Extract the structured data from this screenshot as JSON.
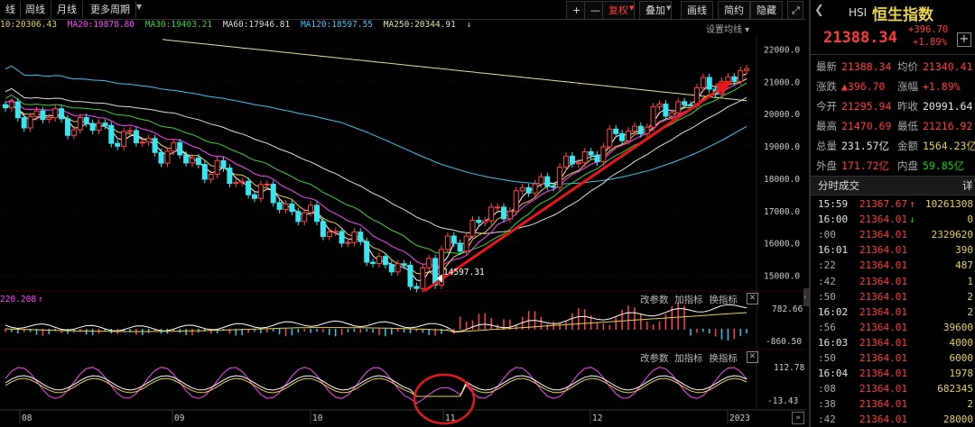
{
  "toolbar": {
    "tabs": [
      "线",
      "周线",
      "月线",
      "更多周期"
    ],
    "buttons": [
      "+",
      "—",
      "复权",
      "叠加",
      "画线",
      "简约",
      "隐藏"
    ]
  },
  "ma_legend": [
    {
      "label": "10:20306.43",
      "color": "#e8d24a"
    },
    {
      "label": "MA20:19878.80",
      "color": "#ff44ff"
    },
    {
      "label": "MA30:19403.21",
      "color": "#39d239"
    },
    {
      "label": "MA60:17946.81",
      "color": "#dddddd"
    },
    {
      "label": "MA120:18597.55",
      "color": "#39c6f0"
    },
    {
      "label": "MA250:20344.91",
      "color": "#e8e0a0"
    }
  ],
  "ma_settings_label": "设置均线",
  "macd_header": "220.208",
  "sub_actions": [
    "改参数",
    "加指标",
    "换指标"
  ],
  "chart_data": [
    {
      "type": "candlestick",
      "y_ticks": [
        "22000.0",
        "21000.0",
        "20000.0",
        "19000.0",
        "18000.0",
        "17000.0",
        "16000.0",
        "15000.0"
      ],
      "ylim": [
        14600,
        22400
      ],
      "x_ticks": [
        "08",
        "09",
        "10",
        "11",
        "12",
        "2023"
      ],
      "annotations": [
        "14597.31"
      ],
      "low_marker": 14597.31
    },
    {
      "type": "line",
      "name": "MACD",
      "y_ticks": [
        "782.66",
        "-860.50"
      ]
    },
    {
      "type": "line",
      "name": "KDJ",
      "y_ticks": [
        "112.78",
        "-13.43"
      ]
    }
  ],
  "quote": {
    "code": "HSI",
    "name": "恒生指数",
    "price": "21388.34",
    "change": "+396.70",
    "change_pct": "+1.89%",
    "fields": [
      {
        "l1": "最新",
        "v1": "21388.34",
        "c1": "red",
        "l2": "均价",
        "v2": "21340.41",
        "c2": "red"
      },
      {
        "l1": "涨跌",
        "v1": "▲396.70",
        "c1": "red",
        "l2": "涨幅",
        "v2": "+1.89%",
        "c2": "red"
      },
      {
        "l1": "今开",
        "v1": "21295.94",
        "c1": "red",
        "l2": "昨收",
        "v2": "20991.64",
        "c2": "white"
      },
      {
        "l1": "最高",
        "v1": "21470.69",
        "c1": "red",
        "l2": "最低",
        "v2": "21216.92",
        "c2": "red"
      },
      {
        "l1": "总量",
        "v1": "231.57亿",
        "c1": "white",
        "l2": "金额",
        "v2": "1564.23亿",
        "c2": "yellow"
      },
      {
        "l1": "外盘",
        "v1": "171.72亿",
        "c1": "red",
        "l2": "内盘",
        "v2": "59.85亿",
        "c2": "green"
      }
    ],
    "ticks_title": "分时成交",
    "ticks_btn": "详",
    "ticks": [
      {
        "time": "15:59",
        "price": "21367.67",
        "arrow": "↑",
        "vol": "10261308",
        "vc": "yellow",
        "tc": "white"
      },
      {
        "time": "16:00",
        "price": "21364.01",
        "arrow": "↓",
        "vol": "0",
        "vc": "yellow",
        "tc": "white"
      },
      {
        "time": ":00",
        "price": "21364.01",
        "arrow": "",
        "vol": "2329620",
        "vc": "yellow",
        "tc": "grey"
      },
      {
        "time": "16:01",
        "price": "21364.01",
        "arrow": "",
        "vol": "390",
        "vc": "yellow",
        "tc": "white"
      },
      {
        "time": ":22",
        "price": "21364.01",
        "arrow": "",
        "vol": "487",
        "vc": "yellow",
        "tc": "grey"
      },
      {
        "time": ":42",
        "price": "21364.01",
        "arrow": "",
        "vol": "1",
        "vc": "yellow",
        "tc": "grey"
      },
      {
        "time": ":50",
        "price": "21364.01",
        "arrow": "",
        "vol": "2",
        "vc": "yellow",
        "tc": "grey"
      },
      {
        "time": "16:02",
        "price": "21364.01",
        "arrow": "",
        "vol": "2",
        "vc": "yellow",
        "tc": "white"
      },
      {
        "time": ":56",
        "price": "21364.01",
        "arrow": "",
        "vol": "39600",
        "vc": "yellow",
        "tc": "grey"
      },
      {
        "time": "16:03",
        "price": "21364.01",
        "arrow": "",
        "vol": "4000",
        "vc": "yellow",
        "tc": "white"
      },
      {
        "time": ":50",
        "price": "21364.01",
        "arrow": "",
        "vol": "6000",
        "vc": "yellow",
        "tc": "grey"
      },
      {
        "time": "16:04",
        "price": "21364.01",
        "arrow": "",
        "vol": "1978",
        "vc": "yellow",
        "tc": "white"
      },
      {
        "time": ":08",
        "price": "21364.01",
        "arrow": "",
        "vol": "682345",
        "vc": "yellow",
        "tc": "grey"
      },
      {
        "time": ":38",
        "price": "21364.01",
        "arrow": "",
        "vol": "2",
        "vc": "yellow",
        "tc": "grey"
      },
      {
        "time": ":42",
        "price": "21364.01",
        "arrow": "",
        "vol": "28000",
        "vc": "yellow",
        "tc": "grey"
      }
    ]
  }
}
